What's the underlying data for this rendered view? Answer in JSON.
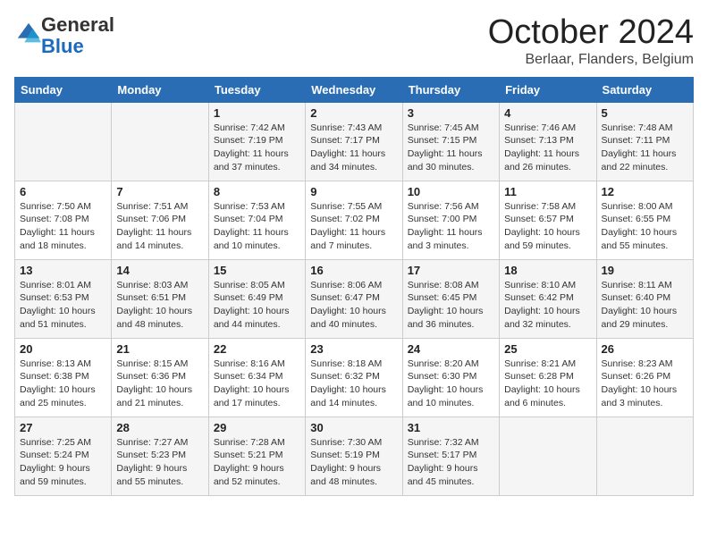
{
  "logo": {
    "general": "General",
    "blue": "Blue"
  },
  "header": {
    "month": "October 2024",
    "location": "Berlaar, Flanders, Belgium"
  },
  "weekdays": [
    "Sunday",
    "Monday",
    "Tuesday",
    "Wednesday",
    "Thursday",
    "Friday",
    "Saturday"
  ],
  "weeks": [
    [
      {
        "day": "",
        "info": ""
      },
      {
        "day": "",
        "info": ""
      },
      {
        "day": "1",
        "info": "Sunrise: 7:42 AM\nSunset: 7:19 PM\nDaylight: 11 hours and 37 minutes."
      },
      {
        "day": "2",
        "info": "Sunrise: 7:43 AM\nSunset: 7:17 PM\nDaylight: 11 hours and 34 minutes."
      },
      {
        "day": "3",
        "info": "Sunrise: 7:45 AM\nSunset: 7:15 PM\nDaylight: 11 hours and 30 minutes."
      },
      {
        "day": "4",
        "info": "Sunrise: 7:46 AM\nSunset: 7:13 PM\nDaylight: 11 hours and 26 minutes."
      },
      {
        "day": "5",
        "info": "Sunrise: 7:48 AM\nSunset: 7:11 PM\nDaylight: 11 hours and 22 minutes."
      }
    ],
    [
      {
        "day": "6",
        "info": "Sunrise: 7:50 AM\nSunset: 7:08 PM\nDaylight: 11 hours and 18 minutes."
      },
      {
        "day": "7",
        "info": "Sunrise: 7:51 AM\nSunset: 7:06 PM\nDaylight: 11 hours and 14 minutes."
      },
      {
        "day": "8",
        "info": "Sunrise: 7:53 AM\nSunset: 7:04 PM\nDaylight: 11 hours and 10 minutes."
      },
      {
        "day": "9",
        "info": "Sunrise: 7:55 AM\nSunset: 7:02 PM\nDaylight: 11 hours and 7 minutes."
      },
      {
        "day": "10",
        "info": "Sunrise: 7:56 AM\nSunset: 7:00 PM\nDaylight: 11 hours and 3 minutes."
      },
      {
        "day": "11",
        "info": "Sunrise: 7:58 AM\nSunset: 6:57 PM\nDaylight: 10 hours and 59 minutes."
      },
      {
        "day": "12",
        "info": "Sunrise: 8:00 AM\nSunset: 6:55 PM\nDaylight: 10 hours and 55 minutes."
      }
    ],
    [
      {
        "day": "13",
        "info": "Sunrise: 8:01 AM\nSunset: 6:53 PM\nDaylight: 10 hours and 51 minutes."
      },
      {
        "day": "14",
        "info": "Sunrise: 8:03 AM\nSunset: 6:51 PM\nDaylight: 10 hours and 48 minutes."
      },
      {
        "day": "15",
        "info": "Sunrise: 8:05 AM\nSunset: 6:49 PM\nDaylight: 10 hours and 44 minutes."
      },
      {
        "day": "16",
        "info": "Sunrise: 8:06 AM\nSunset: 6:47 PM\nDaylight: 10 hours and 40 minutes."
      },
      {
        "day": "17",
        "info": "Sunrise: 8:08 AM\nSunset: 6:45 PM\nDaylight: 10 hours and 36 minutes."
      },
      {
        "day": "18",
        "info": "Sunrise: 8:10 AM\nSunset: 6:42 PM\nDaylight: 10 hours and 32 minutes."
      },
      {
        "day": "19",
        "info": "Sunrise: 8:11 AM\nSunset: 6:40 PM\nDaylight: 10 hours and 29 minutes."
      }
    ],
    [
      {
        "day": "20",
        "info": "Sunrise: 8:13 AM\nSunset: 6:38 PM\nDaylight: 10 hours and 25 minutes."
      },
      {
        "day": "21",
        "info": "Sunrise: 8:15 AM\nSunset: 6:36 PM\nDaylight: 10 hours and 21 minutes."
      },
      {
        "day": "22",
        "info": "Sunrise: 8:16 AM\nSunset: 6:34 PM\nDaylight: 10 hours and 17 minutes."
      },
      {
        "day": "23",
        "info": "Sunrise: 8:18 AM\nSunset: 6:32 PM\nDaylight: 10 hours and 14 minutes."
      },
      {
        "day": "24",
        "info": "Sunrise: 8:20 AM\nSunset: 6:30 PM\nDaylight: 10 hours and 10 minutes."
      },
      {
        "day": "25",
        "info": "Sunrise: 8:21 AM\nSunset: 6:28 PM\nDaylight: 10 hours and 6 minutes."
      },
      {
        "day": "26",
        "info": "Sunrise: 8:23 AM\nSunset: 6:26 PM\nDaylight: 10 hours and 3 minutes."
      }
    ],
    [
      {
        "day": "27",
        "info": "Sunrise: 7:25 AM\nSunset: 5:24 PM\nDaylight: 9 hours and 59 minutes."
      },
      {
        "day": "28",
        "info": "Sunrise: 7:27 AM\nSunset: 5:23 PM\nDaylight: 9 hours and 55 minutes."
      },
      {
        "day": "29",
        "info": "Sunrise: 7:28 AM\nSunset: 5:21 PM\nDaylight: 9 hours and 52 minutes."
      },
      {
        "day": "30",
        "info": "Sunrise: 7:30 AM\nSunset: 5:19 PM\nDaylight: 9 hours and 48 minutes."
      },
      {
        "day": "31",
        "info": "Sunrise: 7:32 AM\nSunset: 5:17 PM\nDaylight: 9 hours and 45 minutes."
      },
      {
        "day": "",
        "info": ""
      },
      {
        "day": "",
        "info": ""
      }
    ]
  ]
}
